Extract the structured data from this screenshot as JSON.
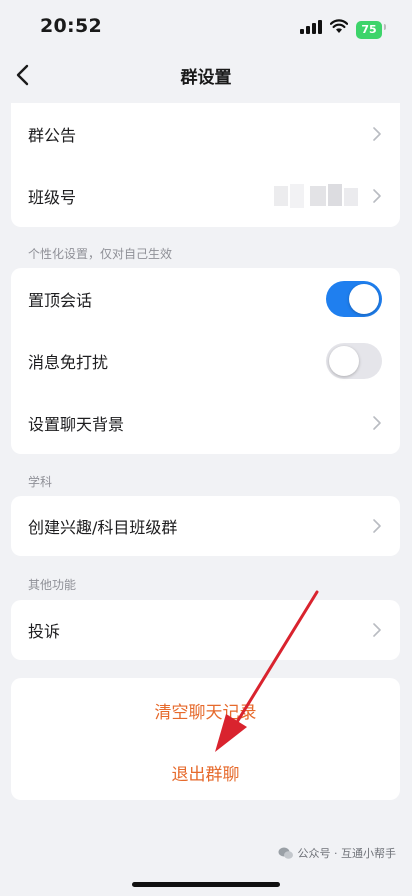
{
  "status_bar": {
    "time": "20:52",
    "battery": "75"
  },
  "nav": {
    "title": "群设置"
  },
  "group_info": {
    "announcement_label": "群公告",
    "class_number_label": "班级号"
  },
  "personalization": {
    "header": "个性化设置，仅对自己生效",
    "pin_chat_label": "置顶会话",
    "pin_chat_on": true,
    "dnd_label": "消息免打扰",
    "dnd_on": false,
    "background_label": "设置聊天背景"
  },
  "subject": {
    "header": "学科",
    "create_group_label": "创建兴趣/科目班级群"
  },
  "other": {
    "header": "其他功能",
    "complaint_label": "投诉"
  },
  "actions": {
    "clear_history": "清空聊天记录",
    "leave_group": "退出群聊"
  },
  "watermark": {
    "text": "公众号 · 互通小帮手"
  },
  "colors": {
    "accent": "#1f7fef",
    "danger_text": "#e66a2c",
    "annotation_arrow": "#d9232e",
    "background": "#f1f2f5"
  }
}
